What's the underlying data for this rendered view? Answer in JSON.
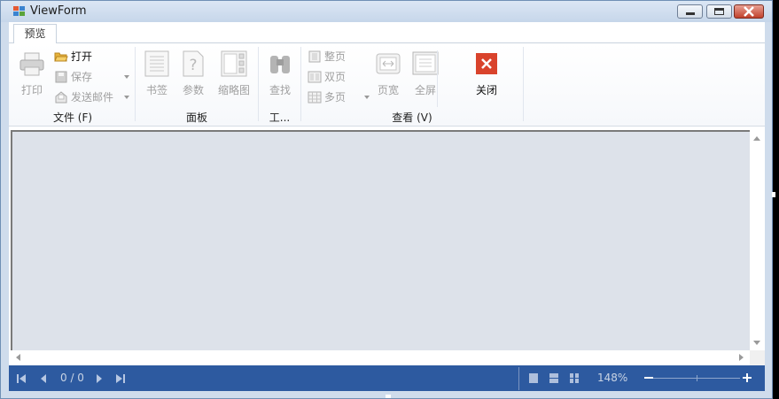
{
  "window": {
    "title": "ViewForm",
    "colors": {
      "accent_blue": "#2d5aa0",
      "close_red": "#d9432c",
      "doc_bg": "#dde2ea"
    }
  },
  "tabs": [
    {
      "label": "预览",
      "active": true
    }
  ],
  "ribbon": {
    "file_group": {
      "label": "文件 (F)",
      "print": {
        "label": "打印",
        "icon": "printer-icon",
        "enabled": false
      },
      "open": {
        "label": "打开",
        "icon": "folder-open-icon",
        "enabled": true
      },
      "save": {
        "label": "保存",
        "icon": "floppy-disk-icon",
        "enabled": false
      },
      "send_email": {
        "label": "发送邮件",
        "icon": "envelope-icon",
        "enabled": false
      }
    },
    "panel_group": {
      "label": "面板",
      "bookmarks": {
        "label": "书签",
        "icon": "bookmark-icon",
        "enabled": false
      },
      "parameters": {
        "label": "参数",
        "icon": "question-doc-icon",
        "enabled": false
      },
      "thumbnails": {
        "label": "缩略图",
        "icon": "thumbnails-icon",
        "enabled": false
      }
    },
    "tools_group": {
      "label": "工...",
      "find": {
        "label": "查找",
        "icon": "binoculars-icon",
        "enabled": false
      }
    },
    "view_group": {
      "label": "查看 (V)",
      "whole_page": {
        "label": "整页",
        "icon": "single-page-icon",
        "enabled": false
      },
      "two_pages": {
        "label": "双页",
        "icon": "two-pages-icon",
        "enabled": false
      },
      "multi_page": {
        "label": "多页",
        "icon": "multi-page-icon",
        "enabled": false
      },
      "page_width": {
        "label": "页宽",
        "icon": "page-width-icon",
        "enabled": false
      },
      "full_screen": {
        "label": "全屏",
        "icon": "full-screen-icon",
        "enabled": false
      }
    },
    "close": {
      "label": "关闭",
      "icon": "close-x-icon",
      "enabled": true
    }
  },
  "status": {
    "page_indicator": "0 / 0",
    "zoom": "148%",
    "zoom_level_fraction": 0.5
  }
}
